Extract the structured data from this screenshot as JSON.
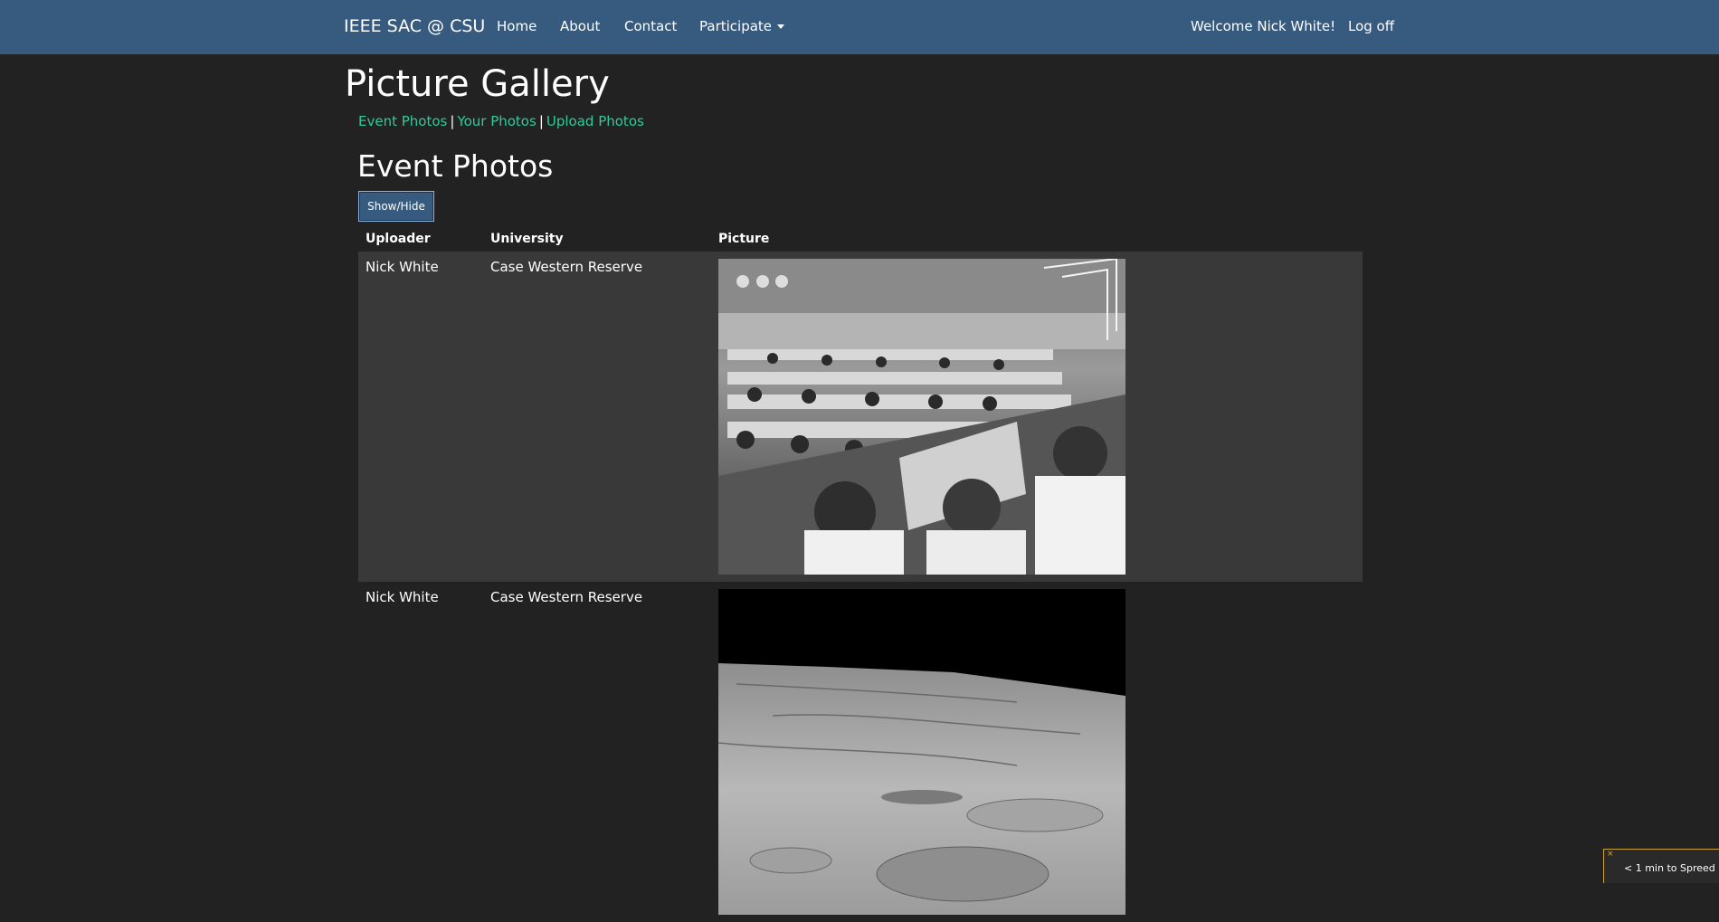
{
  "navbar": {
    "brand": "IEEE SAC @ CSU",
    "links": [
      "Home",
      "About",
      "Contact"
    ],
    "participate": "Participate",
    "welcome": "Welcome Nick White!",
    "logoff": "Log off"
  },
  "page": {
    "title": "Picture Gallery",
    "subnav": {
      "event_photos": "Event Photos",
      "separator": "|",
      "your_photos": "Your Photos",
      "upload_photos": "Upload Photos"
    },
    "section_title": "Event Photos",
    "toggle_button": "Show/Hide"
  },
  "table": {
    "headers": {
      "uploader": "Uploader",
      "university": "University",
      "picture": "Picture"
    },
    "rows": [
      {
        "uploader": "Nick White",
        "university": "Case Western Reserve",
        "picture": "mission-control-room-photo"
      },
      {
        "uploader": "Nick White",
        "university": "Case Western Reserve",
        "picture": "lunar-surface-photo"
      }
    ]
  },
  "toast": {
    "text": "< 1 min to Spreed",
    "close": "×"
  },
  "colors": {
    "navbar": "#375a7f",
    "background": "#222222",
    "link": "#2ecc9a",
    "row_alt": "#393939"
  }
}
